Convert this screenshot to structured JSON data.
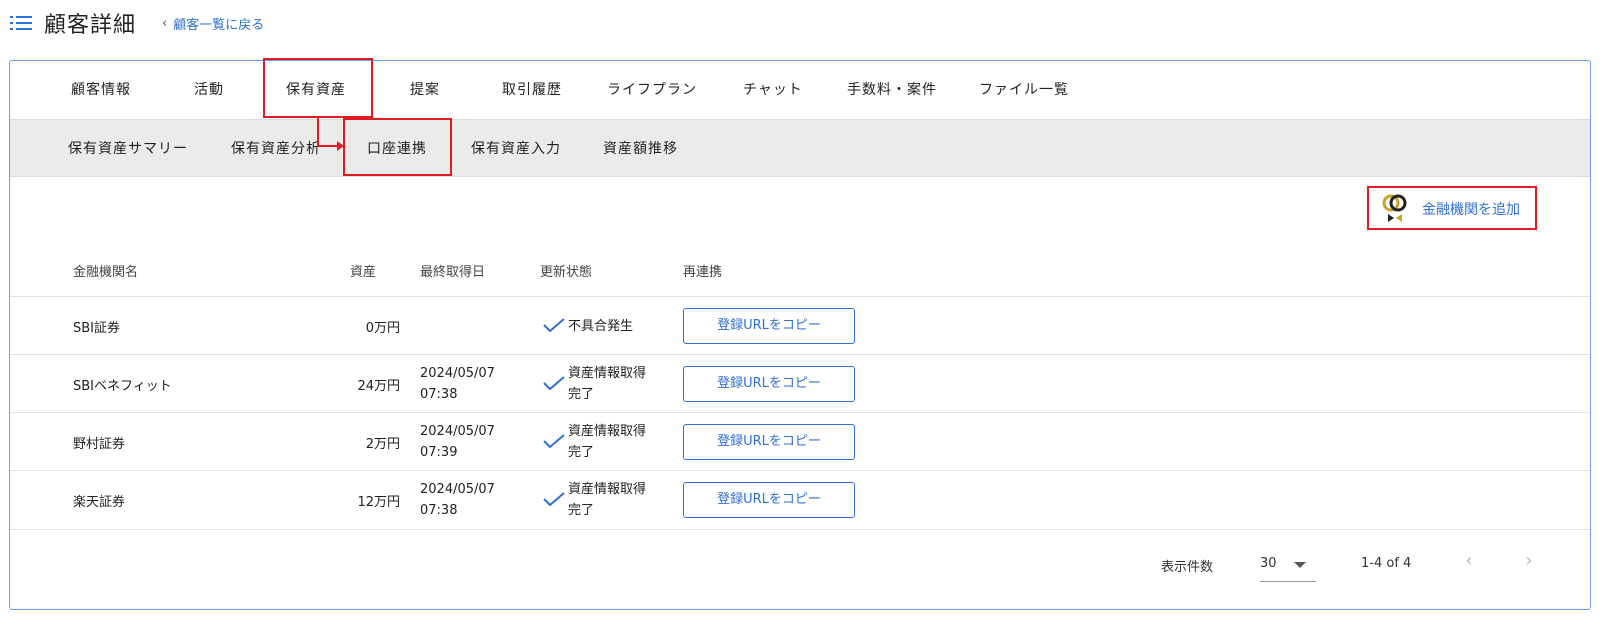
{
  "header": {
    "title": "顧客詳細",
    "back_label": "顧客一覧に戻る"
  },
  "tabs": [
    {
      "label": "顧客情報"
    },
    {
      "label": "活動"
    },
    {
      "label": "保有資産"
    },
    {
      "label": "提案"
    },
    {
      "label": "取引履歴"
    },
    {
      "label": "ライフプラン"
    },
    {
      "label": "チャット"
    },
    {
      "label": "手数料・案件"
    },
    {
      "label": "ファイル一覧"
    }
  ],
  "subtabs": [
    {
      "label": "保有資産サマリー"
    },
    {
      "label": "保有資産分析"
    },
    {
      "label": "口座連携"
    },
    {
      "label": "保有資産入力"
    },
    {
      "label": "資産額推移"
    }
  ],
  "add_button": {
    "label": "金融機関を追加"
  },
  "table": {
    "columns": {
      "name": "金融機関名",
      "asset": "資産",
      "last_fetched": "最終取得日",
      "status": "更新状態",
      "relink": "再連携"
    },
    "rows": [
      {
        "name": "SBI証券",
        "asset": "0万円",
        "date": "",
        "time": "",
        "status_l1": "不具合発生",
        "status_l2": "",
        "button": "登録URLをコピー"
      },
      {
        "name": "SBIベネフィット",
        "asset": "24万円",
        "date": "2024/05/07",
        "time": "07:38",
        "status_l1": "資産情報取得",
        "status_l2": "完了",
        "button": "登録URLをコピー"
      },
      {
        "name": "野村証券",
        "asset": "2万円",
        "date": "2024/05/07",
        "time": "07:39",
        "status_l1": "資産情報取得",
        "status_l2": "完了",
        "button": "登録URLをコピー"
      },
      {
        "name": "楽天証券",
        "asset": "12万円",
        "date": "2024/05/07",
        "time": "07:38",
        "status_l1": "資産情報取得",
        "status_l2": "完了",
        "button": "登録URLをコピー"
      }
    ]
  },
  "pagination": {
    "per_page_label": "表示件数",
    "per_page_value": "30",
    "range": "1-4 of 4"
  },
  "colors": {
    "accent": "#2f6fd8",
    "highlight": "#e11b22"
  }
}
